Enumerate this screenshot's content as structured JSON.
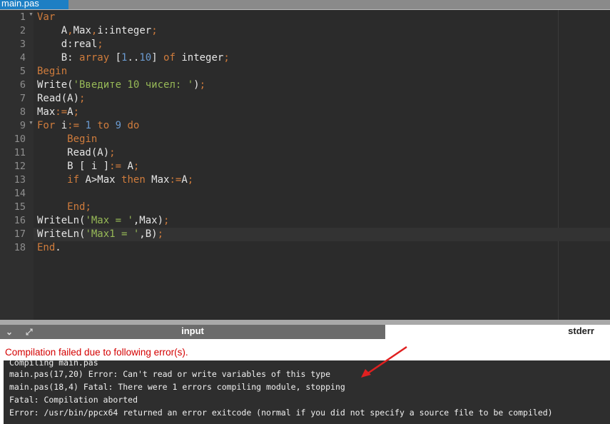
{
  "tab": {
    "label": "main.pas"
  },
  "code": [
    [
      [
        "Var",
        "kw"
      ]
    ],
    [
      [
        "    A",
        "t"
      ],
      [
        ",",
        "op"
      ],
      [
        "Max",
        "t"
      ],
      [
        ",",
        "op"
      ],
      [
        "i:integer",
        "t"
      ],
      [
        ";",
        "op"
      ]
    ],
    [
      [
        "    d:real",
        "t"
      ],
      [
        ";",
        "op"
      ]
    ],
    [
      [
        "    B: ",
        "t"
      ],
      [
        "array",
        "kw"
      ],
      [
        " [",
        "t"
      ],
      [
        "1",
        "num"
      ],
      [
        "..",
        "t"
      ],
      [
        "10",
        "num"
      ],
      [
        "] ",
        "t"
      ],
      [
        "of",
        "kw"
      ],
      [
        " integer",
        "t"
      ],
      [
        ";",
        "op"
      ]
    ],
    [
      [
        "Begin",
        "kw"
      ]
    ],
    [
      [
        "Write(",
        "t"
      ],
      [
        "'Введите 10 чисел: '",
        "str"
      ],
      [
        ")",
        "t"
      ],
      [
        ";",
        "op"
      ]
    ],
    [
      [
        "Read(A)",
        "t"
      ],
      [
        ";",
        "op"
      ]
    ],
    [
      [
        "Max",
        "t"
      ],
      [
        ":=",
        "op"
      ],
      [
        "A",
        "t"
      ],
      [
        ";",
        "op"
      ]
    ],
    [
      [
        "For",
        "kw"
      ],
      [
        " i",
        "t"
      ],
      [
        ":=",
        "op"
      ],
      [
        " ",
        "t"
      ],
      [
        "1",
        "num"
      ],
      [
        " ",
        "t"
      ],
      [
        "to",
        "kw"
      ],
      [
        " ",
        "t"
      ],
      [
        "9",
        "num"
      ],
      [
        " ",
        "t"
      ],
      [
        "do",
        "kw"
      ]
    ],
    [
      [
        "     ",
        "t"
      ],
      [
        "Begin",
        "kw"
      ]
    ],
    [
      [
        "     Read(A)",
        "t"
      ],
      [
        ";",
        "op"
      ]
    ],
    [
      [
        "     B [ i ]",
        "t"
      ],
      [
        ":=",
        "op"
      ],
      [
        " A",
        "t"
      ],
      [
        ";",
        "op"
      ]
    ],
    [
      [
        "     ",
        "t"
      ],
      [
        "if",
        "kw"
      ],
      [
        " A>Max ",
        "t"
      ],
      [
        "then",
        "kw"
      ],
      [
        " Max",
        "t"
      ],
      [
        ":=",
        "op"
      ],
      [
        "A",
        "t"
      ],
      [
        ";",
        "op"
      ]
    ],
    [],
    [
      [
        "     ",
        "t"
      ],
      [
        "End",
        "kw"
      ],
      [
        ";",
        "op"
      ]
    ],
    [
      [
        "WriteLn(",
        "t"
      ],
      [
        "'Max = '",
        "str"
      ],
      [
        ",Max)",
        "t"
      ],
      [
        ";",
        "op"
      ]
    ],
    [
      [
        "WriteLn(",
        "t"
      ],
      [
        "'Max1 = '",
        "str"
      ],
      [
        ",B)",
        "t"
      ],
      [
        ";",
        "op"
      ]
    ],
    [
      [
        "End",
        "kw"
      ],
      [
        ".",
        "t"
      ]
    ]
  ],
  "fold_lines": [
    1,
    9
  ],
  "active_line": 17,
  "panel": {
    "input_tab": "input",
    "stderr_tab": "stderr"
  },
  "error_title": "Compilation failed due to following error(s).",
  "console": [
    "Compiling main.pas",
    "main.pas(17,20) Error: Can't read or write variables of this type",
    "main.pas(18,4) Fatal: There were 1 errors compiling module, stopping",
    "Fatal: Compilation aborted",
    "Error: /usr/bin/ppcx64 returned an error exitcode (normal if you did not specify a source file to be compiled)"
  ]
}
